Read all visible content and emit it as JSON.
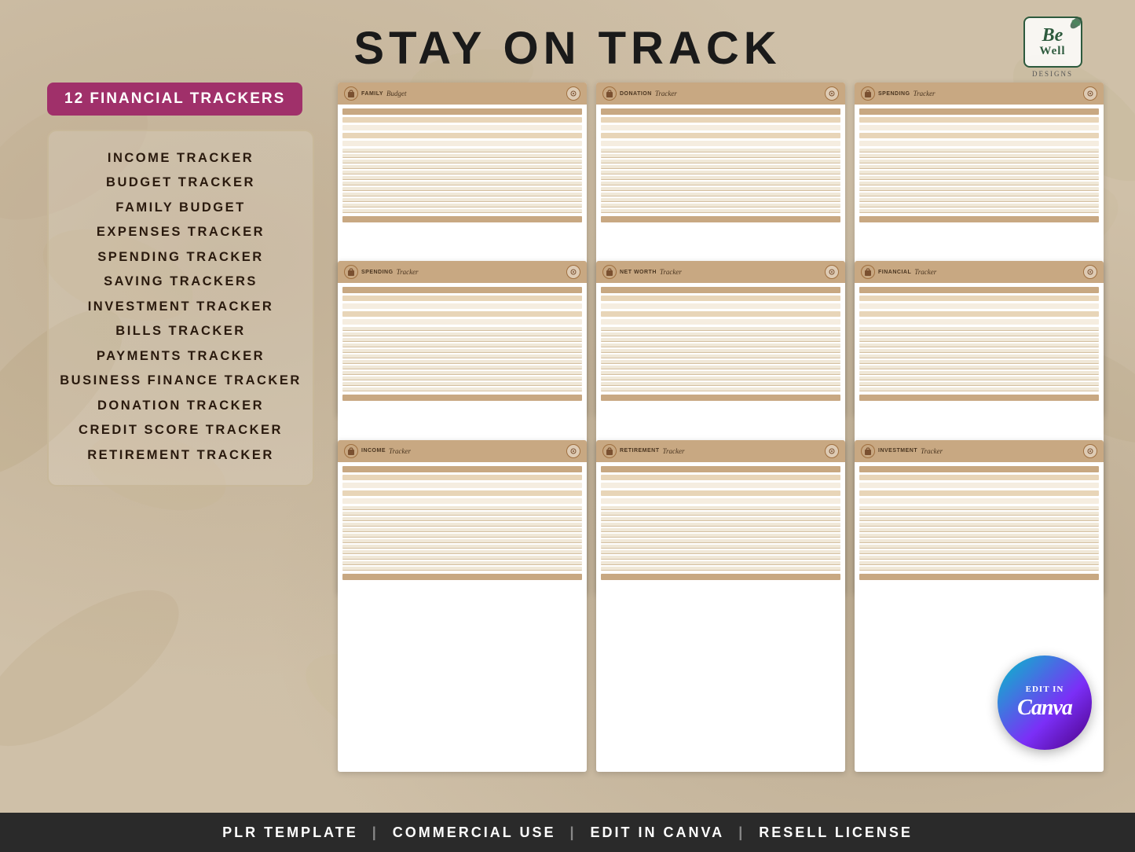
{
  "header": {
    "title": "STAY ON TRACK",
    "logo": {
      "be": "Be",
      "well": "Well",
      "designs": "DESIGNS"
    }
  },
  "badge": {
    "label": "12 FINANCIAL TRACKERS"
  },
  "trackers": {
    "items": [
      "INCOME TRACKER",
      "BUDGET TRACKER",
      "FAMILY BUDGET",
      "EXPENSES TRACKER",
      "SPENDING TRACKER",
      "SAVING TRACKERS",
      "INVESTMENT TRACKER",
      "BILLS TRACKER",
      "PAYMENTS TRACKER",
      "BUSINESS FINANCE TRACKER",
      "DONATION TRACKER",
      "CREDIT SCORE TRACKER",
      "RETIREMENT TRACKER"
    ]
  },
  "documents": [
    {
      "title": "FAMILY",
      "cursive": "Budget"
    },
    {
      "title": "DONATION",
      "cursive": "Tracker"
    },
    {
      "title": "SPENDING",
      "cursive": "Tracker"
    },
    {
      "title": "SPENDING",
      "cursive": "Tracker"
    },
    {
      "title": "NET WORTH",
      "cursive": "Tracker"
    },
    {
      "title": "FINANCIAL",
      "cursive": "Tracker"
    },
    {
      "title": "INCOME",
      "cursive": "Tracker"
    },
    {
      "title": "RETIREMENT",
      "cursive": "Tracker"
    },
    {
      "title": "INVESTMENT",
      "cursive": "Tracker"
    }
  ],
  "canva_badge": {
    "edit_in": "EDIT IN",
    "canva": "Canva"
  },
  "footer": {
    "items": [
      "PLR TEMPLATE",
      "COMMERCIAL USE",
      "EDIT IN CANVA",
      "RESELL LICENSE"
    ],
    "separator": "|"
  }
}
